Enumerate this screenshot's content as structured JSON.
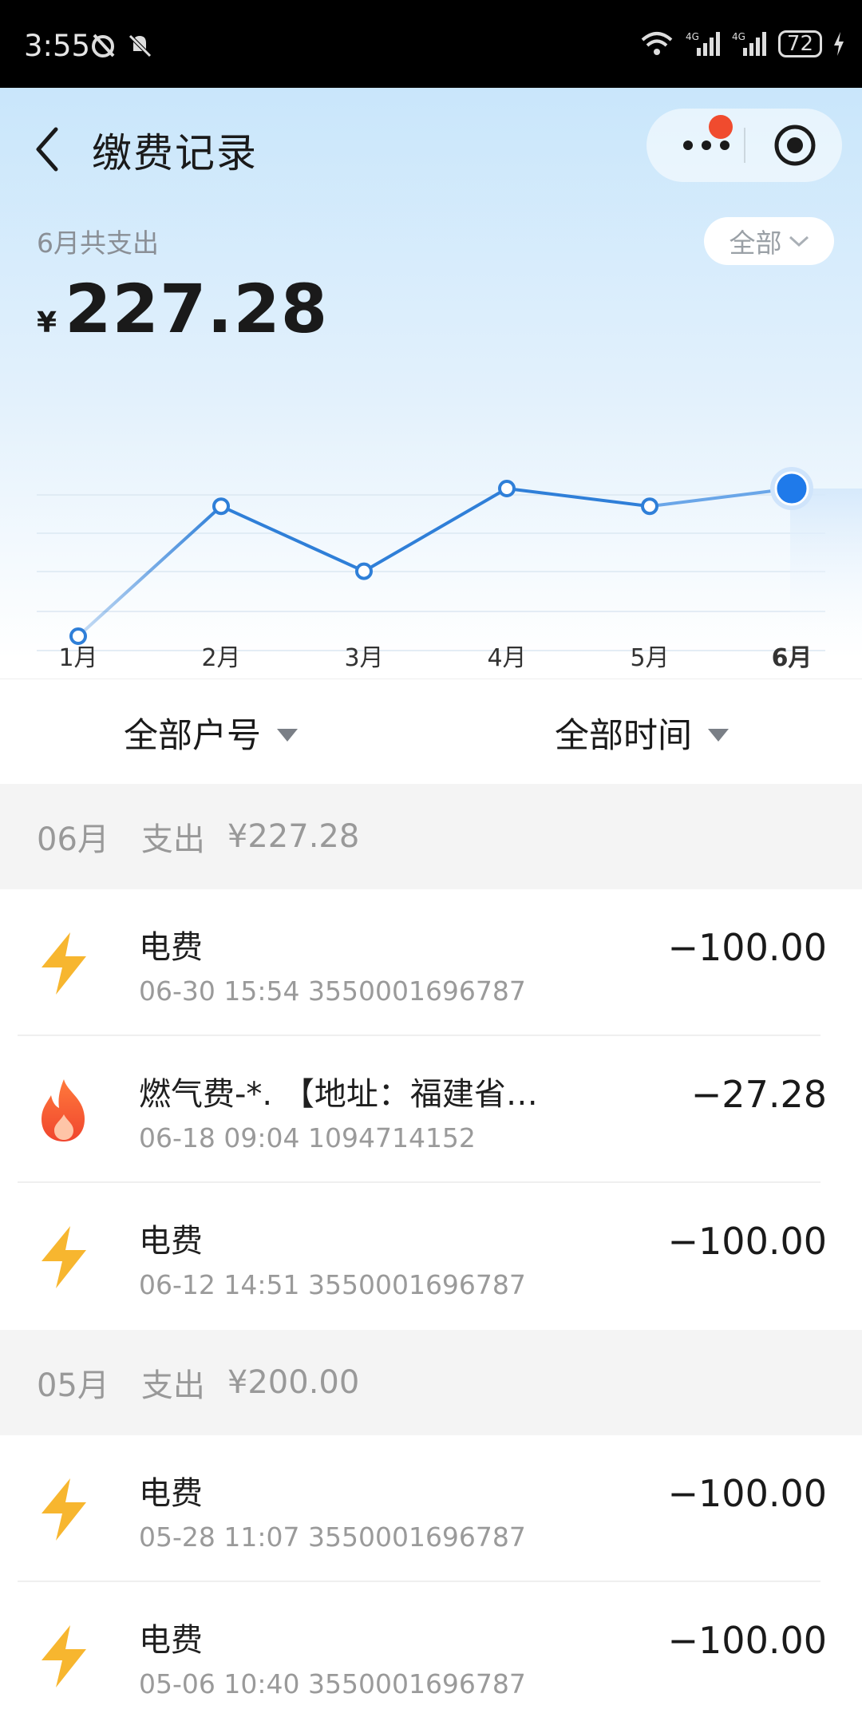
{
  "status_bar": {
    "time": "3:55",
    "network1": "4G",
    "network2": "4G",
    "battery": "72"
  },
  "header": {
    "title": "缴费记录"
  },
  "summary": {
    "label": "6月共支出",
    "currency": "¥",
    "amount": "227.28",
    "filter": "全部"
  },
  "chart_data": {
    "type": "line",
    "categories": [
      "1月",
      "2月",
      "3月",
      "4月",
      "5月",
      "6月"
    ],
    "values": [
      0,
      200,
      100,
      227.28,
      200,
      227.28
    ],
    "highlighted": "6月",
    "colors": {
      "line": "#2f7fd8",
      "highlight": "#1f7aea",
      "label_active": "#2a7fe6"
    }
  },
  "tabs": {
    "account": "全部户号",
    "time": "全部时间"
  },
  "sections": [
    {
      "month": "06月",
      "label": "支出",
      "total": "¥227.28",
      "items": [
        {
          "icon": "lightning-icon",
          "title": "电费",
          "sub": "06-30 15:54 3550001696787",
          "amount": "−100.00"
        },
        {
          "icon": "flame-icon",
          "title": "燃气费-*. 【地址：福建省…",
          "sub": "06-18 09:04 1094714152",
          "amount": "−27.28"
        },
        {
          "icon": "lightning-icon",
          "title": "电费",
          "sub": "06-12 14:51 3550001696787",
          "amount": "−100.00"
        }
      ]
    },
    {
      "month": "05月",
      "label": "支出",
      "total": "¥200.00",
      "items": [
        {
          "icon": "lightning-icon",
          "title": "电费",
          "sub": "05-28 11:07 3550001696787",
          "amount": "−100.00"
        },
        {
          "icon": "lightning-icon",
          "title": "电费",
          "sub": "05-06 10:40 3550001696787",
          "amount": "−100.00"
        }
      ]
    }
  ]
}
